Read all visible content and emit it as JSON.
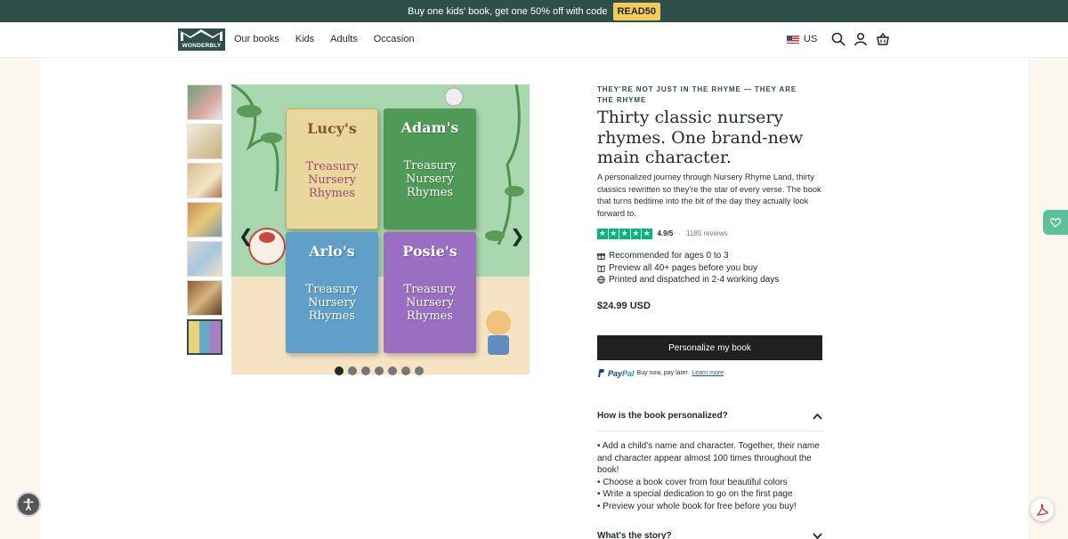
{
  "promo": {
    "text": "Buy one kids' book, get one 50% off with code",
    "code": "READ50"
  },
  "header": {
    "logo_text": "WONDERBLY",
    "nav": [
      "Our books",
      "Kids",
      "Adults",
      "Occasion"
    ],
    "locale": "US"
  },
  "gallery": {
    "book_names": [
      "Lucy's",
      "Adam's",
      "Arlo's",
      "Posie's"
    ],
    "book_subtitle_lines": [
      "Treasury",
      "Nursery",
      "Rhymes"
    ],
    "prev_glyph": "❮",
    "next_glyph": "❯",
    "slide_count": 7,
    "active_slide": 1
  },
  "product": {
    "eyebrow": "THEY'RE NOT JUST IN THE RHYME — THEY ARE THE RHYME",
    "title": "Thirty classic nursery rhymes. One brand-new main character.",
    "description": "A personalized journey through Nursery Rhyme Land, thirty classics rewritten so they're the star of every verse. The book that turns bedtime into the bit of the day they actually look forward to.",
    "rating": {
      "score": "4.9/5",
      "separator": "·",
      "reviews": "1185 reviews",
      "stars": 5
    },
    "features": [
      {
        "icon": "gift-icon",
        "text": "Recommended for ages 0 to 3"
      },
      {
        "icon": "book-icon",
        "text": "Preview all 40+ pages before you buy"
      },
      {
        "icon": "globe-icon",
        "text": "Printed and dispatched in 2-4 working days"
      }
    ],
    "price": "$24.99 USD",
    "cta_label": "Personalize my book",
    "paypal": {
      "logo_left": "Pay",
      "logo_right": "Pal",
      "text": "Buy now, pay later.",
      "link": "Learn more"
    }
  },
  "accordion": {
    "q1": "How is the book personalized?",
    "q1_items": [
      "• Add a child's name and character. Together, their name and character appear almost 100 times throughout the book!",
      "• Choose a book cover from four beautiful colors",
      "• Write a special dedication to go on the first page",
      "• Preview your whole book for free before you buy!"
    ],
    "q2": "What's the story?"
  },
  "colors": {
    "brand": "#2f4f4a",
    "promo_code": "#f3cb5b",
    "trustpilot": "#00b67a",
    "cta": "#202020"
  }
}
